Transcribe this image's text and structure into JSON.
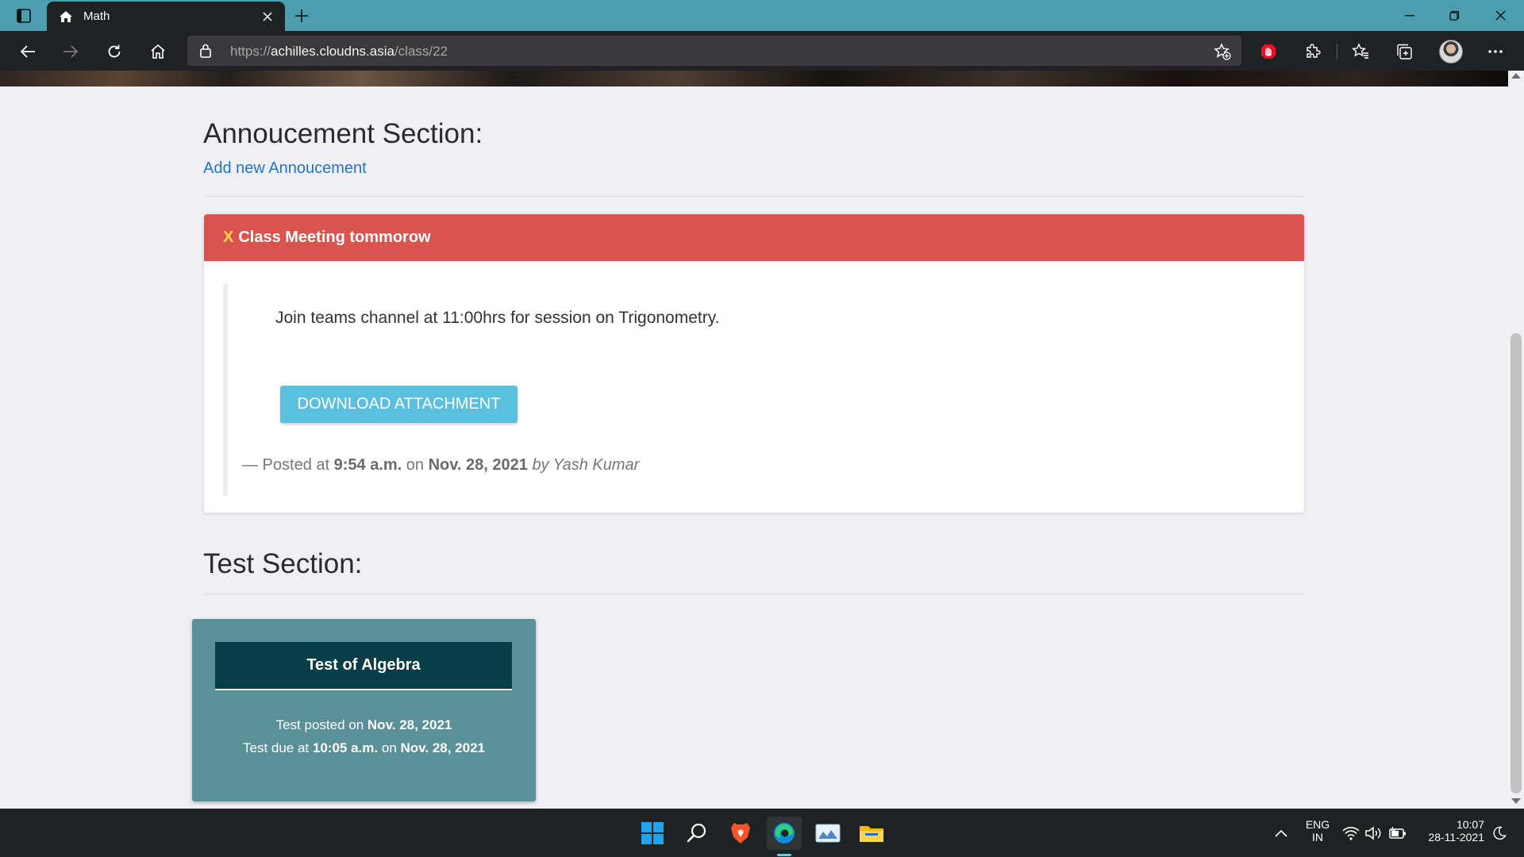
{
  "browser": {
    "tab_title": "Math",
    "url_scheme": "https://",
    "url_host": "achilles.cloudns.asia",
    "url_path": "/class/22"
  },
  "announcement_section": {
    "title": "Annoucement Section:",
    "add_link": "Add new Annoucement",
    "card": {
      "dismiss": "X",
      "title": "Class Meeting tommorow",
      "body": "Join teams channel at 11:00hrs for session on Trigonometry.",
      "button_label": "DOWNLOAD ATTACHMENT",
      "posted_prefix": "— Posted at",
      "posted_time": "9:54 a.m.",
      "posted_on": "on",
      "posted_date": "Nov. 28, 2021",
      "posted_by": "by Yash Kumar"
    }
  },
  "test_section": {
    "title": "Test Section:",
    "card": {
      "title": "Test of Algebra",
      "posted_label": "Test posted on",
      "posted_date": "Nov. 28, 2021",
      "due_label": "Test due at",
      "due_time": "10:05 a.m.",
      "due_on": "on",
      "due_date": "Nov. 28, 2021"
    }
  },
  "taskbar": {
    "lang_line1": "ENG",
    "lang_line2": "IN",
    "time": "10:07",
    "date": "28-11-2021"
  },
  "colors": {
    "tab_bar": "#4a9eae",
    "toolbar": "#202124",
    "announcement_header": "#d9534f",
    "download_button": "#5bc0de",
    "test_card": "#5a9198",
    "test_header": "#093d47",
    "link": "#2673c4"
  },
  "icons": [
    "tab-actions-icon",
    "home-icon",
    "close-icon",
    "plus-icon",
    "minimize-icon",
    "restore-icon",
    "back-icon",
    "forward-icon",
    "refresh-icon",
    "lock-icon",
    "add-favorite-icon",
    "extension-red-hand-icon",
    "extensions-icon",
    "favorites-icon",
    "collections-icon",
    "more-icon",
    "windows-start-icon",
    "search-icon",
    "brave-icon",
    "edge-icon",
    "photos-icon",
    "file-explorer-icon",
    "chevron-up-icon",
    "wifi-icon",
    "volume-icon",
    "battery-icon",
    "moon-icon"
  ]
}
